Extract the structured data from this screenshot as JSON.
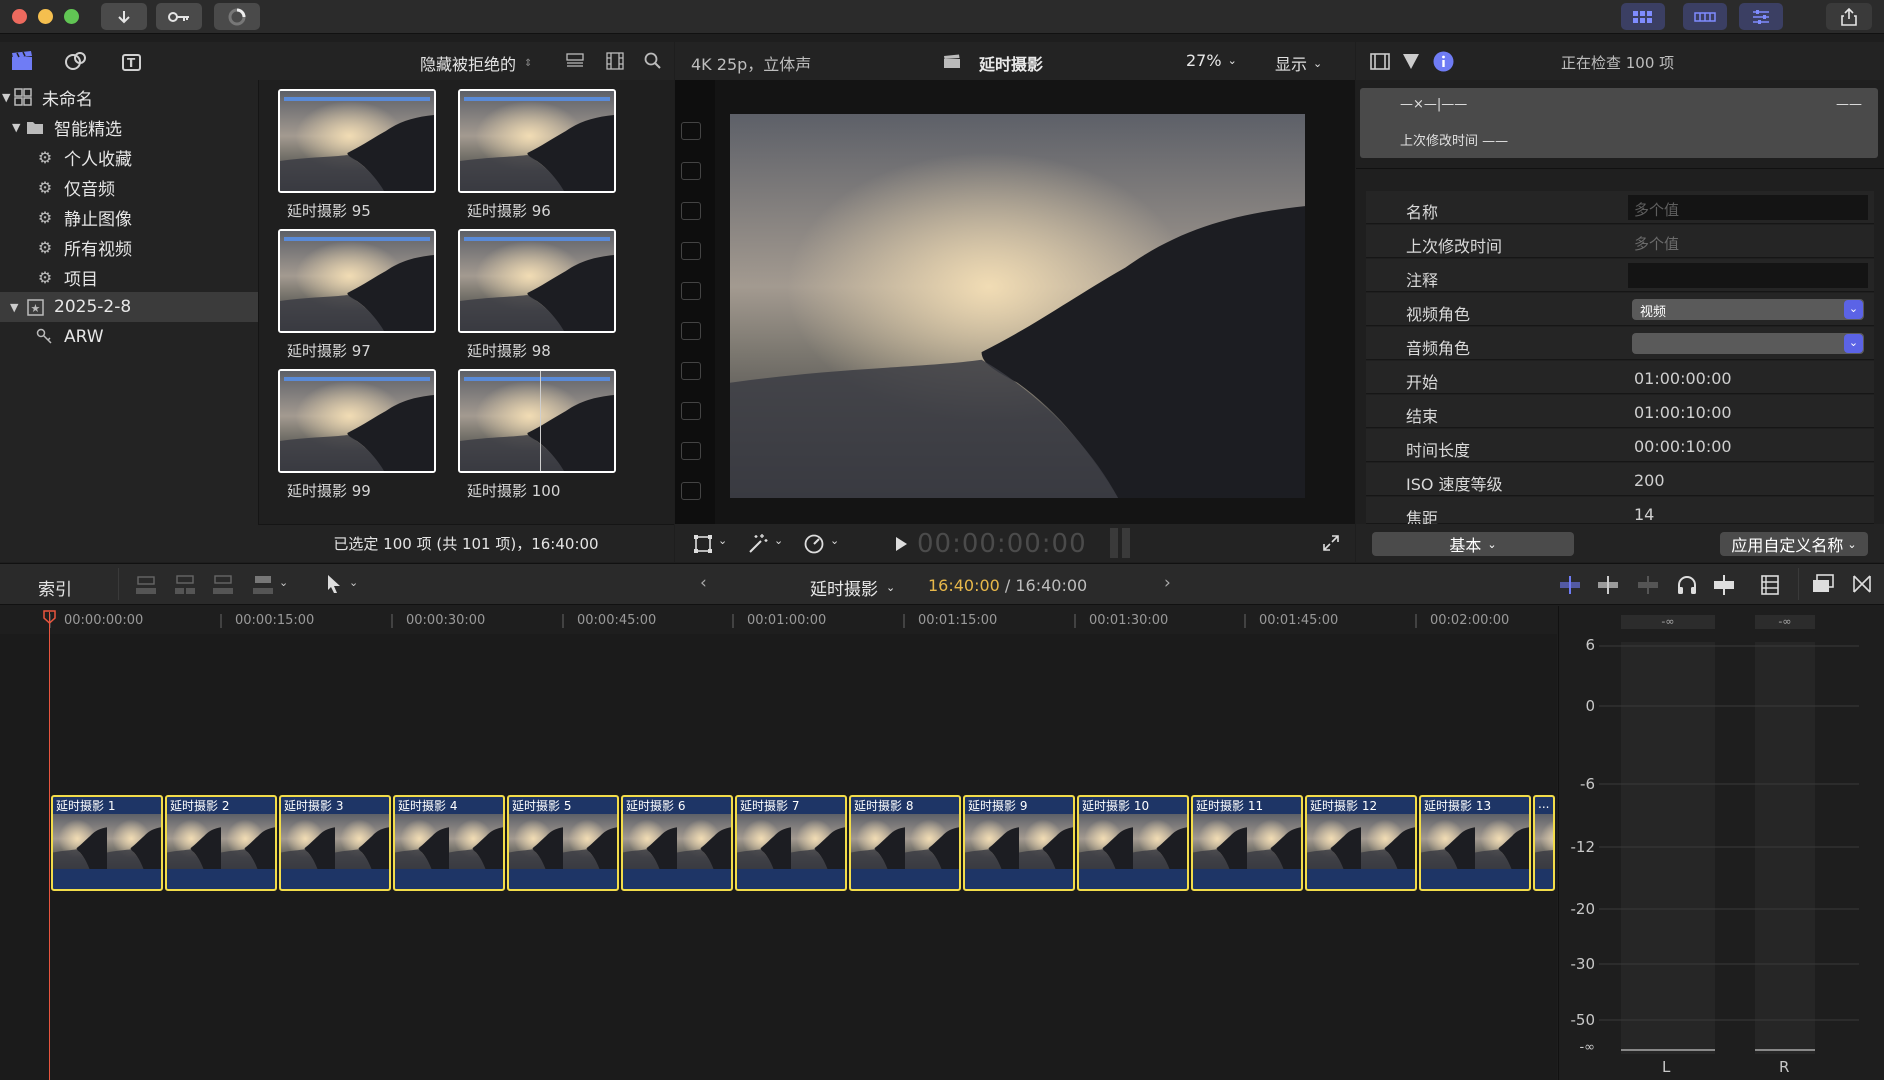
{
  "colors": {
    "accent": "#7f8cff",
    "clip_border": "#f2dc4a",
    "clip_fill": "#1e3566",
    "playhead": "#e8553e"
  },
  "library": {
    "tree": [
      {
        "label": "未命名",
        "icon": "library-grid-icon"
      },
      {
        "label": "智能精选",
        "icon": "folder-icon"
      },
      {
        "label": "个人收藏",
        "icon": "gear-icon"
      },
      {
        "label": "仅音频",
        "icon": "gear-icon"
      },
      {
        "label": "静止图像",
        "icon": "gear-icon"
      },
      {
        "label": "所有视频",
        "icon": "gear-icon"
      },
      {
        "label": "项目",
        "icon": "gear-icon"
      },
      {
        "label": "2025-2-8",
        "icon": "event-star-icon"
      },
      {
        "label": "ARW",
        "icon": "keyword-icon"
      }
    ]
  },
  "browser": {
    "filter_label": "隐藏被拒绝的",
    "clips": [
      {
        "label": "延时摄影 95"
      },
      {
        "label": "延时摄影 96"
      },
      {
        "label": "延时摄影 97"
      },
      {
        "label": "延时摄影 98"
      },
      {
        "label": "延时摄影 99"
      },
      {
        "label": "延时摄影 100"
      }
    ],
    "status": "已选定 100 项 (共 101 项)，16:40:00"
  },
  "viewer": {
    "format": "4K 25p，立体声",
    "title": "延时摄影",
    "zoom": "27%",
    "display_menu": "显示",
    "timecode": "00:00:00:00"
  },
  "inspector": {
    "summary": "正在检查 100 项",
    "header_line1": "—×—|——",
    "header_line1_right": "——",
    "header_line2": "上次修改时间 ——",
    "fields": [
      {
        "key": "名称",
        "value": "多个值"
      },
      {
        "key": "上次修改时间",
        "value": "多个值"
      },
      {
        "key": "注释",
        "value": ""
      },
      {
        "key": "视频角色",
        "value": "视频"
      },
      {
        "key": "音频角色",
        "value": ""
      },
      {
        "key": "开始",
        "value": "01:00:00:00"
      },
      {
        "key": "结束",
        "value": "01:00:10:00"
      },
      {
        "key": "时间长度",
        "value": "00:00:10:00"
      },
      {
        "key": "ISO 速度等级",
        "value": "200"
      },
      {
        "key": "焦距",
        "value": "14"
      }
    ],
    "metadata_view": "基本",
    "apply_names": "应用自定义名称"
  },
  "timeline": {
    "index_label": "索引",
    "project_name": "延时摄影",
    "position": "16:40:00",
    "duration": "/ 16:40:00",
    "ruler": [
      "00:00:00:00",
      "00:00:15:00",
      "00:00:30:00",
      "00:00:45:00",
      "00:01:00:00",
      "00:01:15:00",
      "00:01:30:00",
      "00:01:45:00",
      "00:02:00:00"
    ],
    "clips": [
      "延时摄影 1",
      "延时摄影 2",
      "延时摄影 3",
      "延时摄影 4",
      "延时摄影 5",
      "延时摄影 6",
      "延时摄影 7",
      "延时摄影 8",
      "延时摄影 9",
      "延时摄影 10",
      "延时摄影 11",
      "延时摄影 12",
      "延时摄影 13",
      "..."
    ]
  },
  "meters": {
    "peak_left": "-∞",
    "peak_right": "-∞",
    "scale": [
      "6",
      "0",
      "-6",
      "-12",
      "-20",
      "-30",
      "-50",
      "-∞"
    ],
    "channels": [
      "L",
      "R"
    ]
  }
}
